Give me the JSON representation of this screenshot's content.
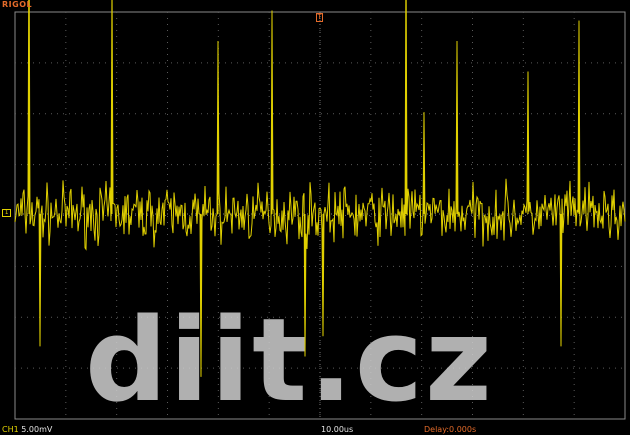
{
  "header": {
    "brand": "RIGOL",
    "trigger_marker": "T"
  },
  "channel_marker": "1",
  "status": {
    "channel": "CH1",
    "volts_per_div": "5.00mV",
    "timebase": "10.00us",
    "delay": "Delay:0.000s"
  },
  "colors": {
    "background": "#000000",
    "trace": "#e0d000",
    "grid": "#5a5a5a",
    "brand": "#e46b2a",
    "watermark": "#cfcfcf"
  },
  "watermark_text": "diit.cz",
  "trace": {
    "baseline_mV": 0,
    "noise_amplitude_mV": 4,
    "spikes": [
      {
        "t_div": -5.72,
        "mV": 29.5
      },
      {
        "t_div": -5.5,
        "mV": -13
      },
      {
        "t_div": -4.1,
        "mV": 23
      },
      {
        "t_div": -2.0,
        "mV": 17
      },
      {
        "t_div": -2.35,
        "mV": -16
      },
      {
        "t_div": -0.95,
        "mV": 20
      },
      {
        "t_div": -0.3,
        "mV": -14
      },
      {
        "t_div": 0.05,
        "mV": -12
      },
      {
        "t_div": 1.7,
        "mV": 27
      },
      {
        "t_div": 2.05,
        "mV": 10
      },
      {
        "t_div": 2.7,
        "mV": 17
      },
      {
        "t_div": 4.1,
        "mV": 14
      },
      {
        "t_div": 5.1,
        "mV": 19
      },
      {
        "t_div": 4.75,
        "mV": -13
      }
    ]
  }
}
